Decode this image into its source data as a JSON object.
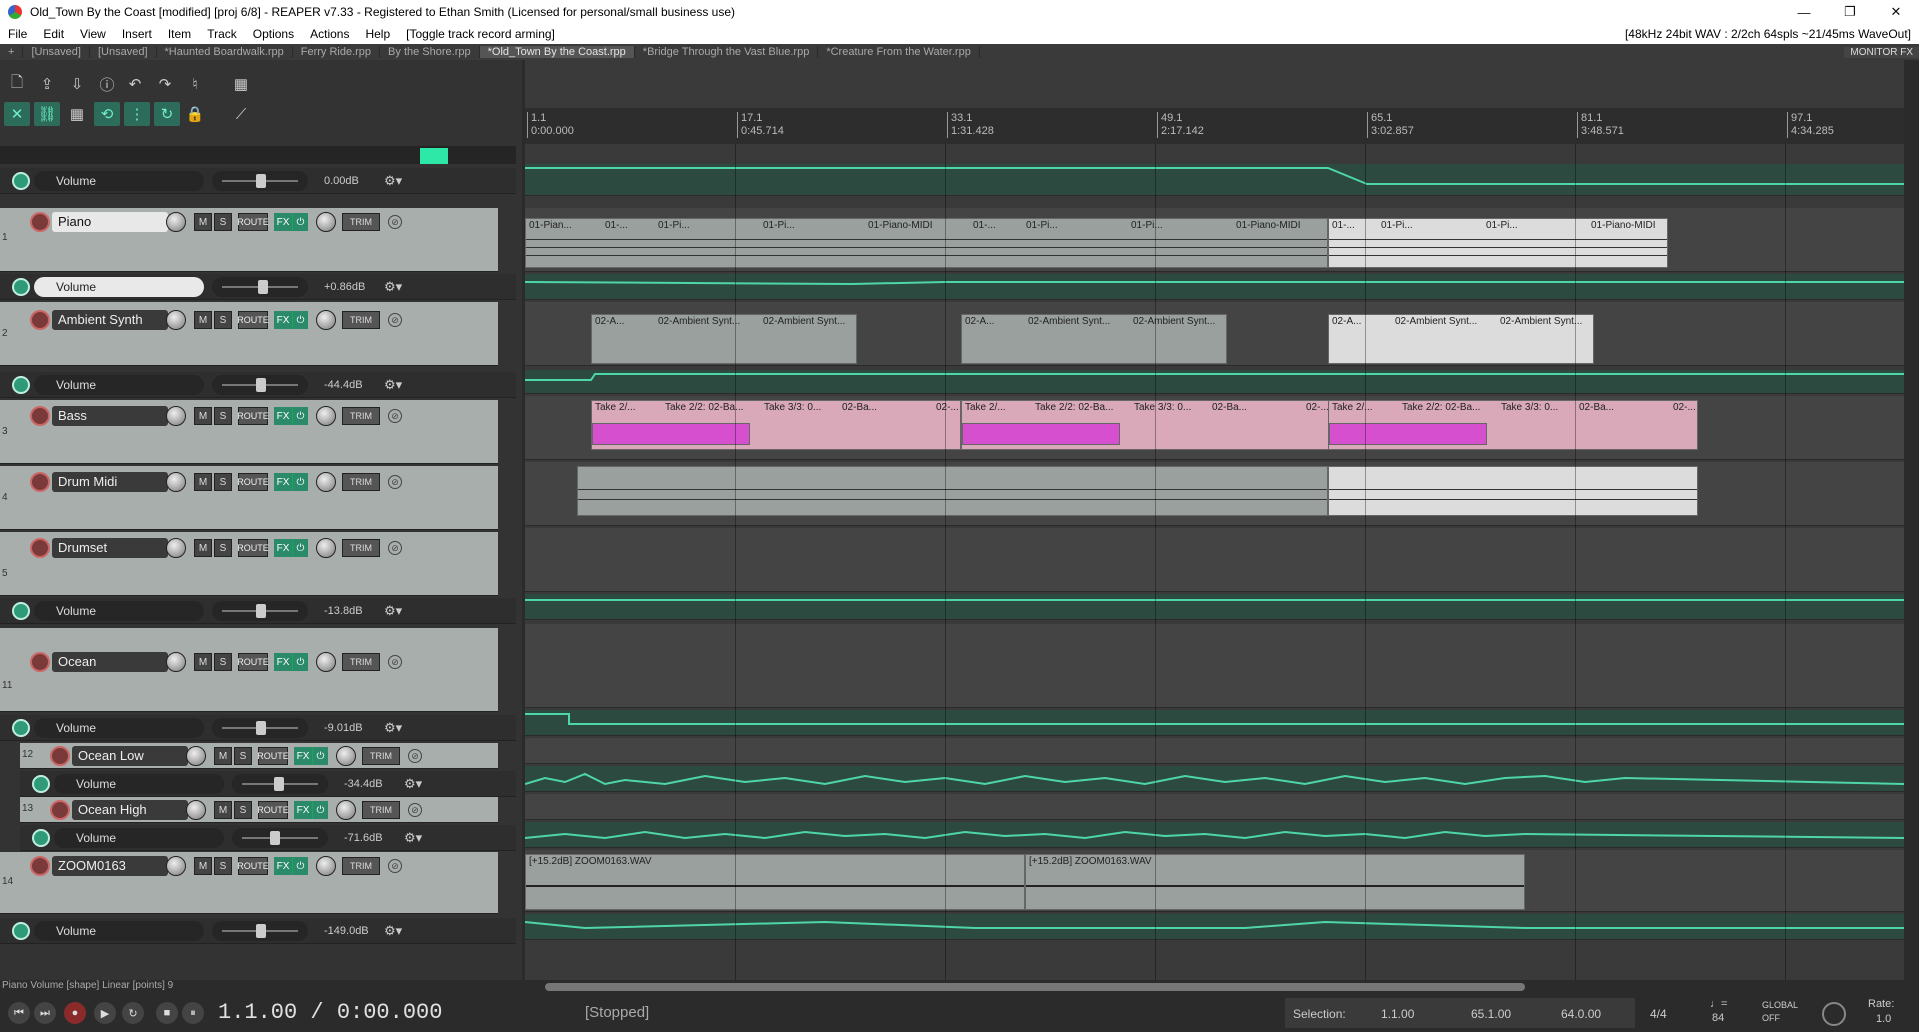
{
  "window": {
    "title": "Old_Town By the Coast [modified] [proj 6/8] - REAPER v7.33 - Registered to Ethan Smith (Licensed for personal/small business use)",
    "minimize": "—",
    "maximize": "❐",
    "close": "✕"
  },
  "menu": {
    "items": [
      "File",
      "Edit",
      "View",
      "Insert",
      "Item",
      "Track",
      "Options",
      "Actions",
      "Help",
      "[Toggle track record arming]"
    ],
    "status": "[48kHz 24bit WAV : 2/2ch 64spls ~21/45ms WaveOut]"
  },
  "tabs": {
    "add": "+",
    "items": [
      "[Unsaved]",
      "[Unsaved]",
      "*Haunted Boardwalk.rpp",
      "Ferry Ride.rpp",
      "By the Shore.rpp",
      "*Old_Town By the Coast.rpp",
      "*Bridge Through the Vast Blue.rpp",
      "*Creature From the Water.rpp"
    ],
    "monitor_fx": "MONITOR FX"
  },
  "ruler": {
    "marks": [
      {
        "bar": "1.1",
        "time": "0:00.000"
      },
      {
        "bar": "17.1",
        "time": "0:45.714"
      },
      {
        "bar": "33.1",
        "time": "1:31.428"
      },
      {
        "bar": "49.1",
        "time": "2:17.142"
      },
      {
        "bar": "65.1",
        "time": "3:02.857"
      },
      {
        "bar": "81.1",
        "time": "3:48.571"
      },
      {
        "bar": "97.1",
        "time": "4:34.285"
      }
    ]
  },
  "master_env": {
    "name": "Volume",
    "value": "0.00dB"
  },
  "tracks": [
    {
      "num": "1",
      "name": "Piano",
      "env": {
        "name": "Volume",
        "value": "+0.86dB"
      }
    },
    {
      "num": "2",
      "name": "Ambient Synth",
      "env": {
        "name": "Volume",
        "value": "-44.4dB"
      }
    },
    {
      "num": "3",
      "name": "Bass"
    },
    {
      "num": "4",
      "name": "Drum Midi"
    },
    {
      "num": "5",
      "name": "Drumset",
      "env": {
        "name": "Volume",
        "value": "-13.8dB"
      }
    },
    {
      "num": "11",
      "name": "Ocean",
      "env": {
        "name": "Volume",
        "value": "-9.01dB"
      }
    },
    {
      "num": "12",
      "name": "Ocean Low",
      "env": {
        "name": "Volume",
        "value": "-34.4dB"
      }
    },
    {
      "num": "13",
      "name": "Ocean High",
      "env": {
        "name": "Volume",
        "value": "-71.6dB"
      }
    },
    {
      "num": "14",
      "name": "ZOOM0163",
      "env": {
        "name": "Volume",
        "value": "-149.0dB"
      }
    }
  ],
  "buttons": {
    "m": "M",
    "s": "S",
    "route": "ROUTE",
    "fx": "FX",
    "fx_power": "⏻",
    "trim": "TRIM"
  },
  "items": {
    "piano": [
      "01-Pian...",
      "01-...",
      "01-Pi...",
      "01-Pi...",
      "01-Piano-MIDI",
      "01-...",
      "01-Pi...",
      "01-Pi...",
      "01-Piano-MIDI",
      "01-...",
      "01-Pi...",
      "01-Pi...",
      "01-Piano-MIDI"
    ],
    "ambient": [
      "02-A...",
      "02-Ambient Synt...",
      "02-Ambient Synt...",
      "02-A...",
      "02-Ambient Synt...",
      "02-Ambient Synt...",
      "02-A...",
      "02-Ambient Synt...",
      "02-Ambient Synt..."
    ],
    "bass": [
      "Take 2/...",
      "Take 2/2: 02-Ba...",
      "Take 3/3: 0...",
      "02-Ba...",
      "02-...",
      "Take 2/...",
      "Take 2/2: 02-Ba...",
      "Take 3/3: 0...",
      "02-Ba...",
      "02-...",
      "Take 2/...",
      "Take 2/2: 02-Ba...",
      "Take 3/3: 0...",
      "02-Ba...",
      "02-..."
    ],
    "zoom": [
      "[+15.2dB] ZOOM0163.WAV",
      "[+15.2dB] ZOOM0163.WAV"
    ]
  },
  "transport": {
    "time": "1.1.00 / 0:00.000",
    "status": "[Stopped]",
    "selection_label": "Selection:",
    "sel_start": "1.1.00",
    "sel_end": "65.1.00",
    "sel_len": "64.0.00",
    "time_sig": "4/4",
    "tempo": "84",
    "global": "GLOBAL",
    "global_state": "OFF",
    "rate_label": "Rate:",
    "rate": "1.0"
  },
  "status_line": "Piano Volume [shape] Linear [points] 9"
}
